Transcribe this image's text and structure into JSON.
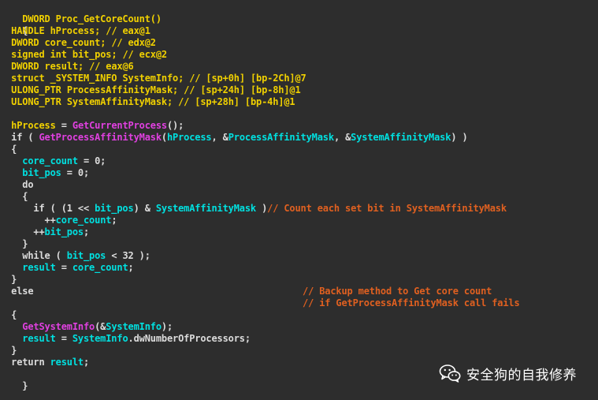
{
  "code": {
    "signature": "DWORD Proc_GetCoreCount()",
    "open_brace": "{",
    "close_brace": "}",
    "decls": {
      "type_handle": "HANDLE",
      "var_hprocess": "hProcess",
      "comment_hprocess": "; // eax@1",
      "type_dword1": "DWORD",
      "var_core_count": "core_count",
      "comment_core_count": "; // edx@2",
      "type_signed": "signed int",
      "var_bit_pos": "bit_pos",
      "comment_bit_pos": "; // ecx@2",
      "type_dword2": "DWORD",
      "var_result": "result",
      "comment_result": "; // eax@6",
      "type_struct": "struct _SYSTEM_INFO",
      "var_sysinfo": "SystemInfo",
      "comment_sysinfo": "; // [sp+0h] [bp-2Ch]@7",
      "type_ulong1": "ULONG_PTR",
      "var_proc_mask": "ProcessAffinityMask",
      "comment_proc_mask": "; // [sp+24h] [bp-8h]@1",
      "type_ulong2": "ULONG_PTR",
      "var_sys_mask": "SystemAffinityMask",
      "comment_sys_mask": "; // [sp+28h] [bp-4h]@1"
    },
    "body": {
      "get_proc_lhs": "hProcess",
      "eq": " = ",
      "get_current_process": "GetCurrentProcess",
      "call_end": "();",
      "if_open": "if ( ",
      "get_affinity": "GetProcessAffinityMask",
      "paren_open": "(",
      "arg_hprocess": "hProcess",
      "comma_amp": ", &",
      "arg_proc_mask": "ProcessAffinityMask",
      "arg_sys_mask": "SystemAffinityMask",
      "if_close": ") )",
      "brace_open": "{",
      "brace_close": "}",
      "core_count_init_var": "core_count",
      "zero_assign": " = 0;",
      "bit_pos_init_var": "bit_pos",
      "do_kw": "do",
      "if2_open": "if ( (1 << ",
      "bit_pos_ref": "bit_pos",
      "amp_mid": ") & ",
      "sys_mask_ref": "SystemAffinityMask",
      "if2_close": " )",
      "comment_count": "// Count each set bit in SystemAffinityMask",
      "inc": "++",
      "core_count_ref": "core_count",
      "semi": ";",
      "while_open": "while ( ",
      "while_close": " < 32 );",
      "result_var": "result",
      "core_count_rhs": "core_count",
      "else_kw": "else",
      "comment_backup1": "// Backup method to Get core count",
      "comment_backup2": "// if GetProcessAffinityMask call fails",
      "get_system_info": "GetSystemInfo",
      "amp_open": "(&",
      "sysinfo_arg": "SystemInfo",
      "close_semi": ");",
      "sysinfo_rhs": "SystemInfo",
      "field_num_procs": ".dwNumberOfProcessors;",
      "return_kw": "return ",
      "return_var": "result"
    }
  },
  "watermark": {
    "icon": "wechat-icon",
    "text": "安全狗的自我修养"
  },
  "colors": {
    "background": "#2d2d2d",
    "default_text": "#dcdcdc",
    "keyword_yellow": "#f0d000",
    "identifier_cyan": "#00e0e0",
    "function_magenta": "#e040e0",
    "comment_orange": "#e06020"
  }
}
